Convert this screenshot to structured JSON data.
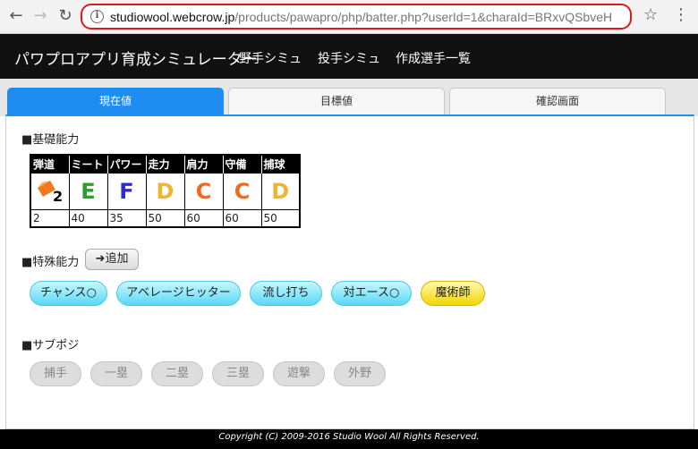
{
  "browser": {
    "url_host": "studiowool.webcrow.jp",
    "url_path": "/products/pawapro/php/batter.php?userId=1&charaId=BRxvQSbveH"
  },
  "header": {
    "title": "パワプロアプリ育成シミュレーター",
    "nav": [
      "野手シミュ",
      "投手シミュ",
      "作成選手一覧"
    ]
  },
  "tabs": [
    "現在値",
    "目標値",
    "確認画面"
  ],
  "basic": {
    "title": "■基礎能力",
    "columns": [
      "弾道",
      "ミート",
      "パワー",
      "走力",
      "肩力",
      "守備",
      "捕球"
    ],
    "grades": [
      "",
      "E",
      "F",
      "D",
      "C",
      "C",
      "D"
    ],
    "trajectory_badge": "2",
    "values": [
      "2",
      "40",
      "35",
      "50",
      "60",
      "60",
      "50"
    ]
  },
  "special": {
    "title": "■特殊能力",
    "add_label": "追加",
    "items": [
      "チャンス○",
      "アベレージヒッター",
      "流し打ち",
      "対エース○",
      "魔術師"
    ]
  },
  "subpos": {
    "title": "■サブポジ",
    "items": [
      "捕手",
      "一塁",
      "二塁",
      "三塁",
      "遊撃",
      "外野"
    ]
  },
  "footer": "Copyright (C) 2009-2016 Studio Wool All Rights Reserved.",
  "colors": {
    "accent": "#1e8cf0",
    "grade_E": "#2aa02a",
    "grade_F": "#2b2bd8",
    "grade_D": "#f2b233",
    "grade_C": "#f06a1e",
    "pill_cyan": "#58d9f3",
    "pill_gold": "#f2d600"
  }
}
